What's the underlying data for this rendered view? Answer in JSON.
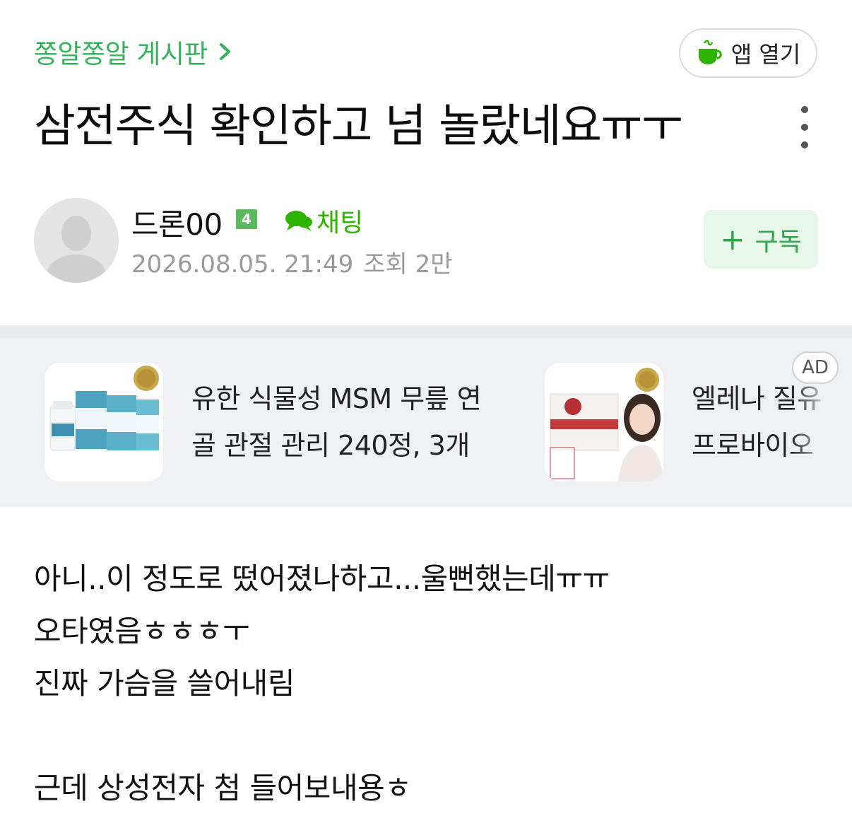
{
  "header": {
    "board_name": "쫑알쫑알 게시판",
    "app_open_label": "앱 열기"
  },
  "post": {
    "title": "삼전주식 확인하고 넘 놀랐네요ㅠㅜ",
    "author": {
      "name": "드론00",
      "level": "4",
      "chat_label": "채팅"
    },
    "datetime": "2026.08.05. 21:49",
    "views": "조회 2만",
    "subscribe_label": "구독",
    "body_lines": [
      "아니..이 정도로 떴어졌나하고...울뻔했는데ㅠㅠ",
      "오타였음ㅎㅎㅎㅜ",
      "진짜 가슴을 쓸어내림",
      "",
      "근데 상성전자 첨 들어보내용ㅎ"
    ]
  },
  "ads": {
    "badge": "AD",
    "items": [
      {
        "line1": "유한 식물성 MSM 무릎 연",
        "line2": "골 관절 관리 240정, 3개"
      },
      {
        "line1": "엘레나 질유",
        "line2": "프로바이오"
      }
    ]
  },
  "colors": {
    "brand_green": "#35b35b",
    "subscribe_bg": "#e6f6e8",
    "ad_bg": "#eef0f3"
  },
  "icons": [
    "chevron-right-icon",
    "cafe-cup-icon",
    "more-vertical-icon",
    "chat-bubble-icon",
    "plus-icon"
  ]
}
